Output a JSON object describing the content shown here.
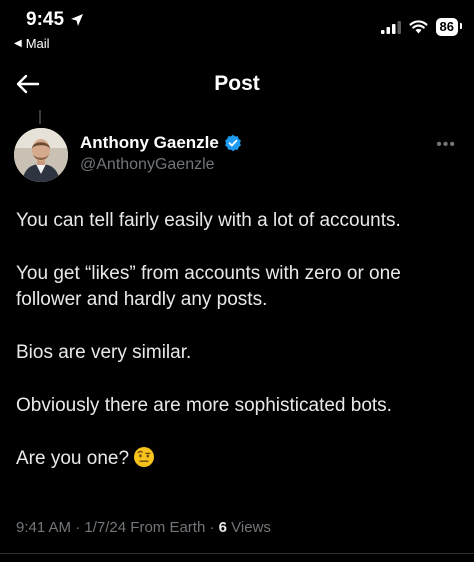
{
  "status_bar": {
    "time": "9:45",
    "back_app": "Mail",
    "battery": "86"
  },
  "nav": {
    "title": "Post"
  },
  "author": {
    "display_name": "Anthony Gaenzle",
    "handle": "@AnthonyGaenzle",
    "verified_color": "#1d9bf0"
  },
  "post": {
    "paragraphs": [
      "You can tell fairly easily with a lot of accounts.",
      "You get “likes” from accounts with zero or one follower and hardly any posts.",
      "Bios are very similar.",
      "Obviously there are more sophisticated bots.",
      "Are you one?"
    ],
    "emoji": "raised-eyebrow-face-icon"
  },
  "meta": {
    "time": "9:41 AM",
    "date": "1/7/24",
    "source": "From Earth",
    "views_count": "6",
    "views_label": "Views",
    "separator": "·"
  },
  "colors": {
    "background": "#000000",
    "text": "#e7e9ea",
    "secondary": "#71767b",
    "accent": "#1d9bf0"
  }
}
